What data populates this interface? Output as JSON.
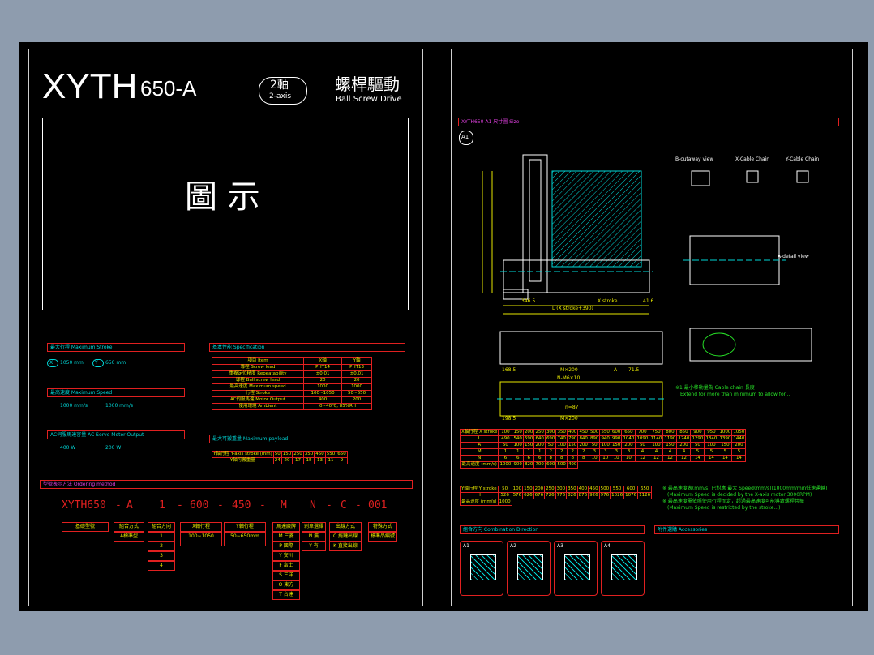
{
  "left": {
    "model": "XYTH",
    "model_suffix": "650-A",
    "axes_badge_main": "2軸",
    "axes_badge_sub": "2-axis",
    "drive_cn": "螺桿驅動",
    "drive_en": "Ball Screw Drive",
    "figure_placeholder": "圖 示",
    "max_stroke": "最大行程  Maximum Stroke",
    "x_stroke": "1050 mm",
    "y_stroke": "650 mm",
    "max_speed": "最高速度  Maximum Speed",
    "x_speed": "1000 mm/s",
    "y_speed": "1000 mm/s",
    "motor_output": "AC伺服馬達容量  AC Servo Motor Output",
    "x_motor": "400 W",
    "y_motor": "200 W",
    "spec_title": "基本性能  Specification",
    "payload_title": "最大可搬重量  Maximum payload",
    "ordering_title": "型號表示方法  Ordering method",
    "ordering_code": [
      "XYTH650",
      "-",
      "A",
      "1",
      "-",
      "600",
      "-",
      "450",
      "-",
      "M",
      "N",
      "-",
      "C",
      "-",
      "001"
    ],
    "order_labels": [
      "基礎型號",
      "組合方式",
      "組合方向",
      "X軸行程",
      "Y軸行程",
      "馬達廠牌",
      "剎車選擇",
      "出線方式",
      "特殊方式"
    ],
    "order_sub_combination": [
      "A標準型"
    ],
    "order_sub_direction": [
      "1",
      "2",
      "3",
      "4"
    ],
    "order_sub_x": "100~1050",
    "order_sub_y": "50~650mm",
    "order_sub_motor": [
      "M 三菱",
      "P 國際",
      "Y 安川",
      "F 富士",
      "S 三洋",
      "O 東方",
      "T 台達"
    ],
    "order_sub_brake": [
      "N 無",
      "Y 有"
    ],
    "order_sub_cable": [
      "C 拖鏈出線",
      "K 直接出線"
    ],
    "order_sub_special": "標準品編號"
  },
  "spec_table": {
    "header": [
      "項目 Item",
      "X軸",
      "Y軸"
    ],
    "rows": [
      [
        "導程 Screw lead",
        "PHT14",
        "PHT13"
      ],
      [
        "重複定位精度 Repeatability",
        "±0.01",
        "±0.01"
      ],
      [
        "導程 Ball screw lead",
        "20",
        "20"
      ],
      [
        "最高速度 Maximum speed",
        "1000",
        "1000"
      ],
      [
        "行程 Stroke",
        "100~1050",
        "50~650"
      ],
      [
        "AC伺服馬達 Motor Output",
        "400",
        "200"
      ],
      [
        "使用環境 Ambient",
        "0~40℃, 85%RH"
      ]
    ]
  },
  "payload_table": {
    "head": [
      "Y軸行程 Y-axis stroke (mm)",
      "50",
      "150",
      "250",
      "350",
      "450",
      "550",
      "650"
    ],
    "vals": [
      "Y軸可搬重量",
      "24",
      "20",
      "17",
      "15",
      "13",
      "11",
      "9"
    ]
  },
  "right": {
    "section_a1": "XYTH650-A1  尺寸圖  Size",
    "a1_badge": "A1",
    "b_cutaway": "B-cutaway view",
    "x_cable": "X-Cable Chain",
    "y_cable": "Y-Cable Chain",
    "a_detail": "A-detail view",
    "dim_346": "346.5",
    "dim_xstroke": "X stroke",
    "dim_416": "41.6",
    "dim_L": "L (X stroke+390)",
    "dim_168": "168.5",
    "dim_M200": "M×200",
    "dim_A": "A",
    "dim_71": "71.5",
    "dim_N": "N-M6×10",
    "dim_188": "198.5",
    "dim_M1200": "M×200",
    "dim_n87": "n=87",
    "note1": "※1 最小移動量為 Cable chain 長度",
    "note2": "Extend for more than minimum to allow for...",
    "section_comb": "組合方向  Combination Direction",
    "section_acc": "附件選購  Accessories",
    "comb_labels": [
      "A1",
      "A2",
      "A3",
      "A4"
    ]
  },
  "x_table": {
    "rows": [
      [
        "X軸行程 X stroke",
        "100",
        "150",
        "200",
        "250",
        "300",
        "350",
        "400",
        "450",
        "500",
        "550",
        "600",
        "650",
        "700",
        "750",
        "800",
        "850",
        "900",
        "950",
        "1000",
        "1050"
      ],
      [
        "L",
        "490",
        "540",
        "590",
        "640",
        "690",
        "740",
        "790",
        "840",
        "890",
        "940",
        "990",
        "1040",
        "1090",
        "1140",
        "1190",
        "1240",
        "1290",
        "1340",
        "1390",
        "1440"
      ],
      [
        "A",
        "50",
        "100",
        "150",
        "200",
        "50",
        "100",
        "150",
        "200",
        "50",
        "100",
        "150",
        "200",
        "50",
        "100",
        "150",
        "200",
        "50",
        "100",
        "150",
        "200"
      ],
      [
        "M",
        "1",
        "1",
        "1",
        "1",
        "2",
        "2",
        "2",
        "2",
        "3",
        "3",
        "3",
        "3",
        "4",
        "4",
        "4",
        "4",
        "5",
        "5",
        "5",
        "5"
      ],
      [
        "N",
        "6",
        "6",
        "6",
        "6",
        "8",
        "8",
        "8",
        "8",
        "10",
        "10",
        "10",
        "10",
        "12",
        "12",
        "12",
        "12",
        "14",
        "14",
        "14",
        "14"
      ],
      [
        "最高速度 (mm/s)",
        "1000",
        "900",
        "820",
        "700",
        "600",
        "500",
        "400"
      ]
    ]
  },
  "y_table": {
    "rows": [
      [
        "Y軸行程 Y stroke",
        "50",
        "100",
        "150",
        "200",
        "250",
        "300",
        "350",
        "400",
        "450",
        "500",
        "550",
        "600",
        "650"
      ],
      [
        "H",
        "526",
        "576",
        "626",
        "676",
        "726",
        "776",
        "826",
        "876",
        "926",
        "976",
        "1026",
        "1076",
        "1126"
      ],
      [
        "最高速度 (mm/s)",
        "1000"
      ]
    ],
    "note_a": "※ 最高速度表(mm/s) 已對應 最大 Speed(mm/s)(1000mm/min低速運轉)",
    "note_b": "(Maximum Speed is decided by the X-axis motor 3000RPM)",
    "note_c": "※ 最高速度需依照使用行程而定，超過最高速度可能導致螺桿共振",
    "note_d": "(Maximum Speed is restricted by the stroke...)"
  },
  "colors": {
    "accent": "#00d8d8",
    "frame": "#e02020",
    "text": "#e6e600",
    "dim": "#27e027"
  }
}
